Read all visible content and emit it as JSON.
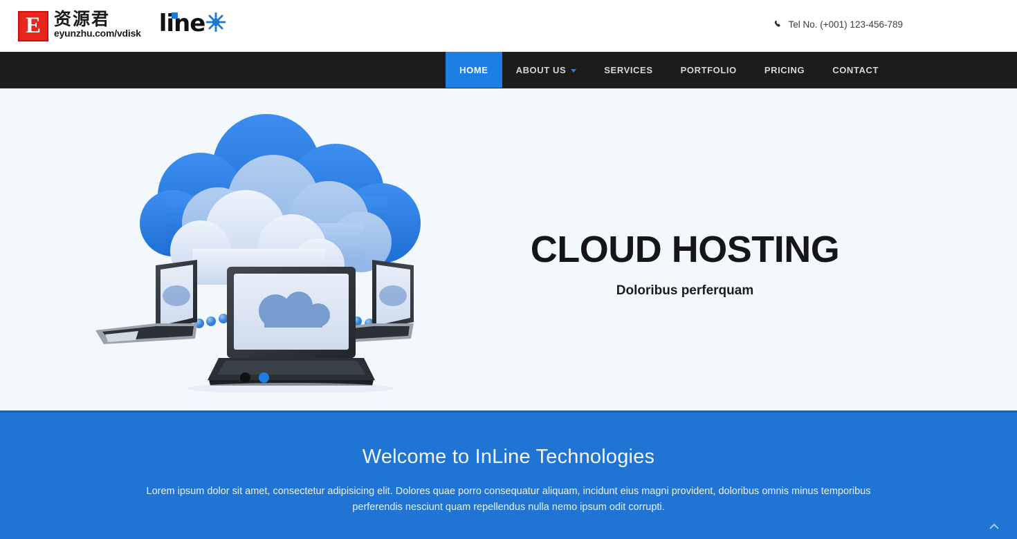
{
  "watermark": {
    "badge_letter": "E",
    "cn_text": "资源君",
    "url_text": "eyunzhu.com/vdisk"
  },
  "brand": {
    "name": "line",
    "star_icon": "starburst-icon",
    "accent_color": "#1c7ad6"
  },
  "header": {
    "phone_icon": "phone-icon",
    "phone_text": "Tel No. (+001) 123-456-789"
  },
  "nav": {
    "active_color": "#1d7fe4",
    "bar_color": "#1c1c1c",
    "items": [
      {
        "label": "HOME",
        "active": true,
        "has_dropdown": false
      },
      {
        "label": "ABOUT US",
        "active": false,
        "has_dropdown": true
      },
      {
        "label": "SERVICES",
        "active": false,
        "has_dropdown": false
      },
      {
        "label": "PORTFOLIO",
        "active": false,
        "has_dropdown": false
      },
      {
        "label": "PRICING",
        "active": false,
        "has_dropdown": false
      },
      {
        "label": "CONTACT",
        "active": false,
        "has_dropdown": false
      }
    ]
  },
  "hero": {
    "background_color": "#f3f8fd",
    "illustration": "cloud-computing-laptops-illustration",
    "title": "CLOUD HOSTING",
    "subtitle": "Doloribus perferquam",
    "dots": [
      {
        "name": "slide-dot-1",
        "color": "#111111"
      },
      {
        "name": "slide-dot-2",
        "color": "#1d7fe4"
      }
    ]
  },
  "welcome": {
    "background_color": "#1f74d4",
    "title": "Welcome to InLine Technologies",
    "paragraph": "Lorem ipsum dolor sit amet, consectetur adipisicing elit. Dolores quae porro consequatur aliquam, incidunt eius magni provident, doloribus omnis minus temporibus perferendis nesciunt quam repellendus nulla nemo ipsum odit corrupti."
  },
  "scroll_top": {
    "icon": "chevron-up-icon"
  }
}
